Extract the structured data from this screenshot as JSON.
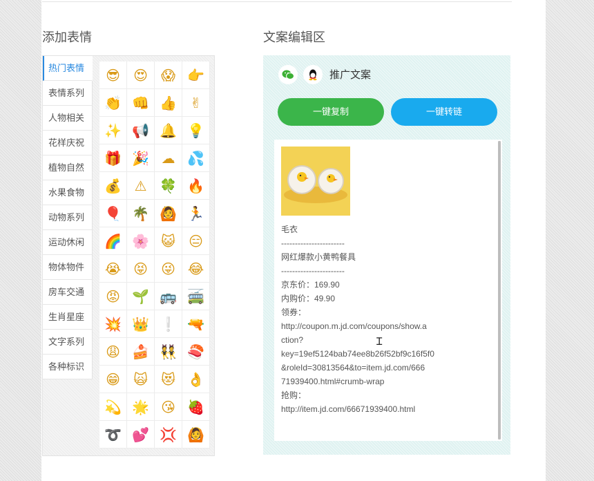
{
  "emoji_section": {
    "title": "添加表情",
    "categories": [
      "热门表情",
      "表情系列",
      "人物相关",
      "花样庆祝",
      "植物自然",
      "水果食物",
      "动物系列",
      "运动休闲",
      "物体物件",
      "房车交通",
      "生肖星座",
      "文字系列",
      "各种标识"
    ],
    "active_category": "热门表情",
    "emojis": [
      "😎",
      "😍",
      "😱",
      "👉",
      "👏",
      "👊",
      "👍",
      "✌",
      "✨",
      "📢",
      "🔔",
      "💡",
      "🎁",
      "🎉",
      "☁",
      "💦",
      "💰",
      "⚠",
      "🍀",
      "🔥",
      "🎈",
      "🌴",
      "🙆",
      "🏃",
      "🌈",
      "🌸",
      "😺",
      "😑",
      "😭",
      "😝",
      "😜",
      "😂",
      "😡",
      "🌱",
      "🚌",
      "🚎",
      "💥",
      "👑",
      "❕",
      "🔫",
      "😩",
      "🍰",
      "👯",
      "🍣",
      "😁",
      "🙀",
      "😻",
      "👌",
      "💫",
      "🌟",
      "😘",
      "🍓",
      "➰",
      "💕",
      "💢",
      "🙆"
    ]
  },
  "editor_section": {
    "title": "文案编辑区",
    "platform_icons": [
      "wechat-icon",
      "qq-icon"
    ],
    "promo_label": "推广文案",
    "copy_button": "一键复制",
    "link_button": "一键转链",
    "content_lines": [
      "毛衣",
      "-----------------------",
      "网红爆款小黄鸭餐具",
      "-----------------------",
      "京东价：169.90",
      "内购价：49.90",
      "领券：",
      "http://coupon.m.jd.com/coupons/show.a",
      "ction?",
      "key=19ef5124bab74ee8b26f52bf9c16f5f0",
      "&roleId=30813564&to=item.jd.com/666",
      "71939400.html#crumb-wrap",
      "抢购：",
      "http://item.jd.com/66671939400.html"
    ]
  },
  "colors": {
    "copy_button": "#3bb54a",
    "link_button": "#19aaee",
    "active_tab": "#2a8ae0",
    "editor_bg": "#dff2f1"
  }
}
